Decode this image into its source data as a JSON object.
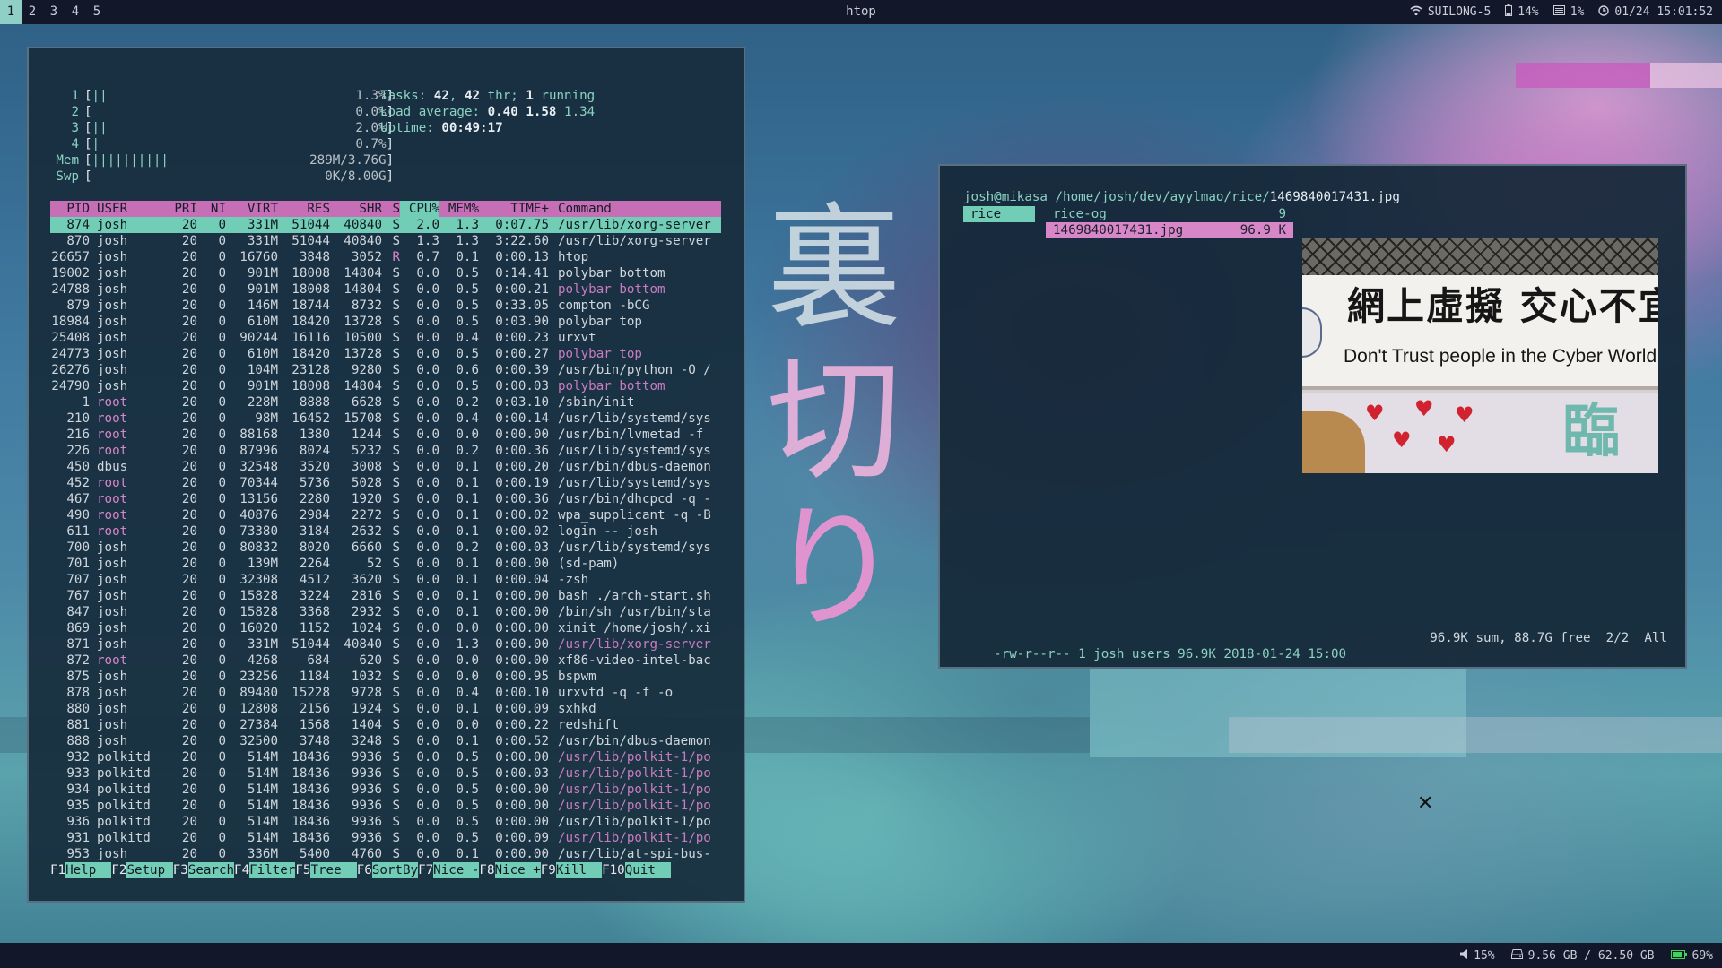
{
  "topbar": {
    "workspaces": [
      "1",
      "2",
      "3",
      "4",
      "5"
    ],
    "active_workspace": "1",
    "title": "htop",
    "wifi_icon": "wifi-icon",
    "network": "SUILONG-5",
    "battery_icon": "battery-icon",
    "battery": "14%",
    "cpu_icon": "cpu-icon",
    "cpu": "1%",
    "clock_icon": "clock-icon",
    "datetime": "01/24 15:01:52"
  },
  "bottombar": {
    "volume": "15%",
    "disk": "9.56 GB / 62.50 GB",
    "battery": "69%"
  },
  "htop": {
    "meters": [
      {
        "label": "1",
        "bar": "||",
        "value": "1.3%"
      },
      {
        "label": "2",
        "bar": "",
        "value": "0.0%"
      },
      {
        "label": "3",
        "bar": "||",
        "value": "2.0%"
      },
      {
        "label": "4",
        "bar": "|",
        "value": "0.7%"
      },
      {
        "label": "Mem",
        "bar": "||||||||||",
        "value": "289M/3.76G"
      },
      {
        "label": "Swp",
        "bar": "",
        "value": "0K/8.00G"
      }
    ],
    "tasks_label": "Tasks: ",
    "tasks": "42",
    "thr": "42",
    "thr_label": " thr; ",
    "running": "1",
    "running_label": " running",
    "load_label": "Load average: ",
    "load1": "0.40",
    "load5": "1.58",
    "load15": "1.34",
    "uptime_label": "Uptime: ",
    "uptime": "00:49:17",
    "headers": [
      "PID",
      "USER",
      "PRI",
      "NI",
      "VIRT",
      "RES",
      "SHR",
      "S",
      "CPU%",
      "MEM%",
      "TIME+",
      "Command"
    ],
    "processes": [
      [
        "874",
        "josh",
        "20",
        "0",
        "331M",
        "51044",
        "40840",
        "S",
        "2.0",
        "1.3",
        "0:07.75",
        "/usr/lib/xorg-server"
      ],
      [
        "870",
        "josh",
        "20",
        "0",
        "331M",
        "51044",
        "40840",
        "S",
        "1.3",
        "1.3",
        "3:22.60",
        "/usr/lib/xorg-server"
      ],
      [
        "26657",
        "josh",
        "20",
        "0",
        "16760",
        "3848",
        "3052",
        "R",
        "0.7",
        "0.1",
        "0:00.13",
        "htop"
      ],
      [
        "19002",
        "josh",
        "20",
        "0",
        "901M",
        "18008",
        "14804",
        "S",
        "0.0",
        "0.5",
        "0:14.41",
        "polybar bottom"
      ],
      [
        "24788",
        "josh",
        "20",
        "0",
        "901M",
        "18008",
        "14804",
        "S",
        "0.0",
        "0.5",
        "0:00.21",
        "polybar bottom"
      ],
      [
        "879",
        "josh",
        "20",
        "0",
        "146M",
        "18744",
        "8732",
        "S",
        "0.0",
        "0.5",
        "0:33.05",
        "compton -bCG"
      ],
      [
        "18984",
        "josh",
        "20",
        "0",
        "610M",
        "18420",
        "13728",
        "S",
        "0.0",
        "0.5",
        "0:03.90",
        "polybar top"
      ],
      [
        "25408",
        "josh",
        "20",
        "0",
        "90244",
        "16116",
        "10500",
        "S",
        "0.0",
        "0.4",
        "0:00.23",
        "urxvt"
      ],
      [
        "24773",
        "josh",
        "20",
        "0",
        "610M",
        "18420",
        "13728",
        "S",
        "0.0",
        "0.5",
        "0:00.27",
        "polybar top"
      ],
      [
        "26276",
        "josh",
        "20",
        "0",
        "104M",
        "23128",
        "9280",
        "S",
        "0.0",
        "0.6",
        "0:00.39",
        "/usr/bin/python -O /"
      ],
      [
        "24790",
        "josh",
        "20",
        "0",
        "901M",
        "18008",
        "14804",
        "S",
        "0.0",
        "0.5",
        "0:00.03",
        "polybar bottom"
      ],
      [
        "1",
        "root",
        "20",
        "0",
        "228M",
        "8888",
        "6628",
        "S",
        "0.0",
        "0.2",
        "0:03.10",
        "/sbin/init"
      ],
      [
        "210",
        "root",
        "20",
        "0",
        "98M",
        "16452",
        "15708",
        "S",
        "0.0",
        "0.4",
        "0:00.14",
        "/usr/lib/systemd/sys"
      ],
      [
        "216",
        "root",
        "20",
        "0",
        "88168",
        "1380",
        "1244",
        "S",
        "0.0",
        "0.0",
        "0:00.00",
        "/usr/bin/lvmetad -f"
      ],
      [
        "226",
        "root",
        "20",
        "0",
        "87996",
        "8024",
        "5232",
        "S",
        "0.0",
        "0.2",
        "0:00.36",
        "/usr/lib/systemd/sys"
      ],
      [
        "450",
        "dbus",
        "20",
        "0",
        "32548",
        "3520",
        "3008",
        "S",
        "0.0",
        "0.1",
        "0:00.20",
        "/usr/bin/dbus-daemon"
      ],
      [
        "452",
        "root",
        "20",
        "0",
        "70344",
        "5736",
        "5028",
        "S",
        "0.0",
        "0.1",
        "0:00.19",
        "/usr/lib/systemd/sys"
      ],
      [
        "467",
        "root",
        "20",
        "0",
        "13156",
        "2280",
        "1920",
        "S",
        "0.0",
        "0.1",
        "0:00.36",
        "/usr/bin/dhcpcd -q -"
      ],
      [
        "490",
        "root",
        "20",
        "0",
        "40876",
        "2984",
        "2272",
        "S",
        "0.0",
        "0.1",
        "0:00.02",
        "wpa_supplicant -q -B"
      ],
      [
        "611",
        "root",
        "20",
        "0",
        "73380",
        "3184",
        "2632",
        "S",
        "0.0",
        "0.1",
        "0:00.02",
        "login -- josh"
      ],
      [
        "700",
        "josh",
        "20",
        "0",
        "80832",
        "8020",
        "6660",
        "S",
        "0.0",
        "0.2",
        "0:00.03",
        "/usr/lib/systemd/sys"
      ],
      [
        "701",
        "josh",
        "20",
        "0",
        "139M",
        "2264",
        "52",
        "S",
        "0.0",
        "0.1",
        "0:00.00",
        "(sd-pam)"
      ],
      [
        "707",
        "josh",
        "20",
        "0",
        "32308",
        "4512",
        "3620",
        "S",
        "0.0",
        "0.1",
        "0:00.04",
        "-zsh"
      ],
      [
        "767",
        "josh",
        "20",
        "0",
        "15828",
        "3224",
        "2816",
        "S",
        "0.0",
        "0.1",
        "0:00.00",
        "bash ./arch-start.sh"
      ],
      [
        "847",
        "josh",
        "20",
        "0",
        "15828",
        "3368",
        "2932",
        "S",
        "0.0",
        "0.1",
        "0:00.00",
        "/bin/sh /usr/bin/sta"
      ],
      [
        "869",
        "josh",
        "20",
        "0",
        "16020",
        "1152",
        "1024",
        "S",
        "0.0",
        "0.0",
        "0:00.00",
        "xinit /home/josh/.xi"
      ],
      [
        "871",
        "josh",
        "20",
        "0",
        "331M",
        "51044",
        "40840",
        "S",
        "0.0",
        "1.3",
        "0:00.00",
        "/usr/lib/xorg-server"
      ],
      [
        "872",
        "root",
        "20",
        "0",
        "4268",
        "684",
        "620",
        "S",
        "0.0",
        "0.0",
        "0:00.00",
        "xf86-video-intel-bac"
      ],
      [
        "875",
        "josh",
        "20",
        "0",
        "23256",
        "1184",
        "1032",
        "S",
        "0.0",
        "0.0",
        "0:00.95",
        "bspwm"
      ],
      [
        "878",
        "josh",
        "20",
        "0",
        "89480",
        "15228",
        "9728",
        "S",
        "0.0",
        "0.4",
        "0:00.10",
        "urxvtd -q -f -o"
      ],
      [
        "880",
        "josh",
        "20",
        "0",
        "12808",
        "2156",
        "1924",
        "S",
        "0.0",
        "0.1",
        "0:00.09",
        "sxhkd"
      ],
      [
        "881",
        "josh",
        "20",
        "0",
        "27384",
        "1568",
        "1404",
        "S",
        "0.0",
        "0.0",
        "0:00.22",
        "redshift"
      ],
      [
        "888",
        "josh",
        "20",
        "0",
        "32500",
        "3748",
        "3248",
        "S",
        "0.0",
        "0.1",
        "0:00.52",
        "/usr/bin/dbus-daemon"
      ],
      [
        "932",
        "polkitd",
        "20",
        "0",
        "514M",
        "18436",
        "9936",
        "S",
        "0.0",
        "0.5",
        "0:00.00",
        "/usr/lib/polkit-1/po"
      ],
      [
        "933",
        "polkitd",
        "20",
        "0",
        "514M",
        "18436",
        "9936",
        "S",
        "0.0",
        "0.5",
        "0:00.03",
        "/usr/lib/polkit-1/po"
      ],
      [
        "934",
        "polkitd",
        "20",
        "0",
        "514M",
        "18436",
        "9936",
        "S",
        "0.0",
        "0.5",
        "0:00.00",
        "/usr/lib/polkit-1/po"
      ],
      [
        "935",
        "polkitd",
        "20",
        "0",
        "514M",
        "18436",
        "9936",
        "S",
        "0.0",
        "0.5",
        "0:00.00",
        "/usr/lib/polkit-1/po"
      ],
      [
        "936",
        "polkitd",
        "20",
        "0",
        "514M",
        "18436",
        "9936",
        "S",
        "0.0",
        "0.5",
        "0:00.00",
        "/usr/lib/polkit-1/po"
      ],
      [
        "931",
        "polkitd",
        "20",
        "0",
        "514M",
        "18436",
        "9936",
        "S",
        "0.0",
        "0.5",
        "0:00.09",
        "/usr/lib/polkit-1/po"
      ],
      [
        "953",
        "josh",
        "20",
        "0",
        "336M",
        "5400",
        "4760",
        "S",
        "0.0",
        "0.1",
        "0:00.00",
        "/usr/lib/at-spi-bus-"
      ]
    ],
    "thread_rows": [
      4,
      8,
      10,
      26,
      33,
      34,
      35,
      36,
      38
    ],
    "fkeys": [
      {
        "key": "F1",
        "label": "Help  "
      },
      {
        "key": "F2",
        "label": "Setup "
      },
      {
        "key": "F3",
        "label": "Search"
      },
      {
        "key": "F4",
        "label": "Filter"
      },
      {
        "key": "F5",
        "label": "Tree  "
      },
      {
        "key": "F6",
        "label": "SortBy"
      },
      {
        "key": "F7",
        "label": "Nice -"
      },
      {
        "key": "F8",
        "label": "Nice +"
      },
      {
        "key": "F9",
        "label": "Kill  "
      },
      {
        "key": "F10",
        "label": "Quit  "
      }
    ]
  },
  "kanji": [
    "裏",
    "切",
    "り"
  ],
  "ranger": {
    "host": "josh@mikasa",
    "dir": " /home/josh/dev/ayylmao/rice/",
    "file": "1469840017431.jpg",
    "parent_dir": "rice",
    "entries": [
      {
        "name": "rice-og",
        "size": "9",
        "selected": false
      },
      {
        "name": "1469840017431.jpg",
        "size": "96.9 K",
        "selected": true
      }
    ],
    "status_left": "-rw-r--r-- 1 josh users 96.9K 2018-01-24 15:00",
    "status_right": "96.9K sum, 88.7G free  2/2  All",
    "preview": {
      "sign_zh": "網上虛擬 交心不宜",
      "sign_en": "Don't Trust people in the Cyber World",
      "sign_zh_bottom": "臨"
    }
  }
}
